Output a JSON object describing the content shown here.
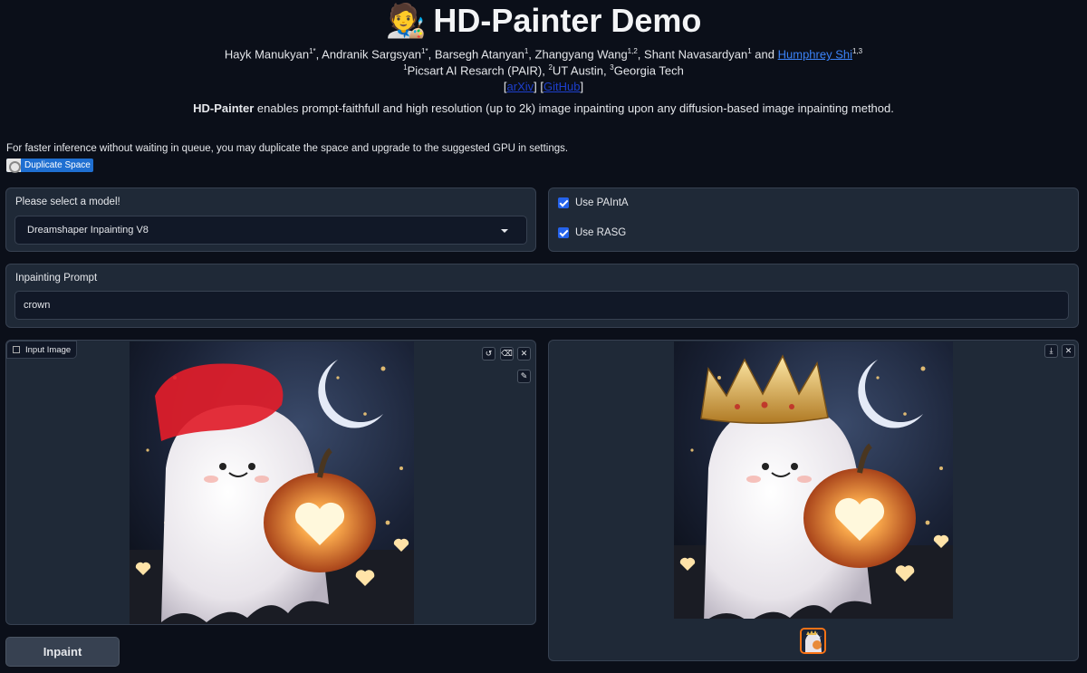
{
  "header": {
    "title_emoji": "🧑‍🎨",
    "title": "HD-Painter Demo",
    "authors": [
      {
        "name": "Hayk Manukyan",
        "sup": "1*"
      },
      {
        "name": "Andranik Sargsyan",
        "sup": "1*"
      },
      {
        "name": "Barsegh Atanyan",
        "sup": "1"
      },
      {
        "name": "Zhangyang Wang",
        "sup": "1,2"
      },
      {
        "name": "Shant Navasardyan",
        "sup": "1"
      }
    ],
    "and_text": "and",
    "last_author": {
      "name": "Humphrey Shi",
      "sup": "1,3"
    },
    "affiliations": [
      {
        "sup": "1",
        "name": "Picsart AI Resarch (PAIR),"
      },
      {
        "sup": "2",
        "name": "UT Austin,"
      },
      {
        "sup": "3",
        "name": "Georgia Tech"
      }
    ],
    "links": {
      "arxiv": "arXiv",
      "github": "GitHub"
    },
    "description_bold": "HD-Painter",
    "description_rest": " enables prompt-faithfull and high resolution (up to 2k) image inpainting upon any diffusion-based image inpainting method."
  },
  "duplicate": {
    "note": "For faster inference without waiting in queue, you may duplicate the space and upgrade to the suggested GPU in settings.",
    "badge_label": "Duplicate Space"
  },
  "model": {
    "label": "Please select a model!",
    "selected": "Dreamshaper Inpainting V8"
  },
  "options": {
    "painta_label": "Use PAIntA",
    "painta_checked": true,
    "rasg_label": "Use RASG",
    "rasg_checked": true
  },
  "prompt": {
    "label": "Inpainting Prompt",
    "value": "crown"
  },
  "input_image": {
    "label": "Input Image",
    "tools": [
      "undo-icon",
      "clear-icon",
      "close-icon",
      "brush-icon"
    ]
  },
  "output_image": {
    "tools": [
      "download-icon",
      "close-icon"
    ]
  },
  "actions": {
    "inpaint_label": "Inpaint"
  },
  "colors": {
    "background": "#0b0f19",
    "panel": "#1f2937",
    "accent": "#2563eb",
    "mask": "#e11d2a",
    "thumb_border": "#f97316"
  }
}
